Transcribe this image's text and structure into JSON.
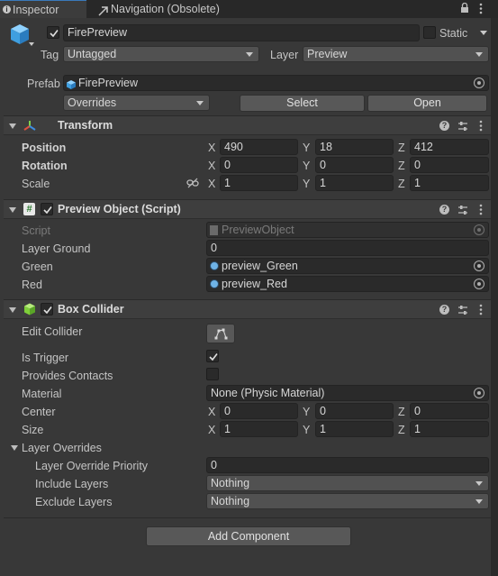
{
  "tabs": [
    {
      "label": "Inspector"
    },
    {
      "label": "Navigation (Obsolete)"
    }
  ],
  "gameobject": {
    "name": "FirePreview",
    "static_label": "Static",
    "tag_label": "Tag",
    "tag_value": "Untagged",
    "layer_label": "Layer",
    "layer_value": "Preview",
    "prefab_label": "Prefab",
    "prefab_value": "FirePreview",
    "overrides_value": "Overrides",
    "select_label": "Select",
    "open_label": "Open"
  },
  "transform": {
    "title": "Transform",
    "position_label": "Position",
    "rotation_label": "Rotation",
    "scale_label": "Scale",
    "position": {
      "x": "490",
      "y": "18",
      "z": "412"
    },
    "rotation": {
      "x": "0",
      "y": "0",
      "z": "0"
    },
    "scale": {
      "x": "1",
      "y": "1",
      "z": "1"
    },
    "axis_x": "X",
    "axis_y": "Y",
    "axis_z": "Z"
  },
  "preview": {
    "title": "Preview Object (Script)",
    "script_label": "Script",
    "script_value": "PreviewObject",
    "layer_ground_label": "Layer Ground",
    "layer_ground_value": "0",
    "green_label": "Green",
    "green_value": "preview_Green",
    "red_label": "Red",
    "red_value": "preview_Red"
  },
  "collider": {
    "title": "Box Collider",
    "edit_label": "Edit Collider",
    "is_trigger_label": "Is Trigger",
    "is_trigger": true,
    "provides_contacts_label": "Provides Contacts",
    "provides_contacts": false,
    "material_label": "Material",
    "material_value": "None (Physic Material)",
    "center_label": "Center",
    "size_label": "Size",
    "center": {
      "x": "0",
      "y": "0",
      "z": "0"
    },
    "size": {
      "x": "1",
      "y": "1",
      "z": "1"
    },
    "layer_overrides_label": "Layer Overrides",
    "priority_label": "Layer Override Priority",
    "priority_value": "0",
    "include_label": "Include Layers",
    "include_value": "Nothing",
    "exclude_label": "Exclude Layers",
    "exclude_value": "Nothing"
  },
  "add_component_label": "Add Component",
  "colors": {
    "background": "#383838",
    "field": "#2a2a2a",
    "header": "#3e3e3e",
    "accent_blue": "#3a79bb"
  },
  "icons": [
    "info-icon",
    "navigation-icon",
    "lock-icon",
    "menu-icon",
    "cube-icon",
    "transform-icon",
    "script-icon",
    "box-collider-icon",
    "help-icon",
    "preset-icon",
    "more-icon",
    "link-icon",
    "object-picker-icon",
    "edit-collider-icon"
  ]
}
